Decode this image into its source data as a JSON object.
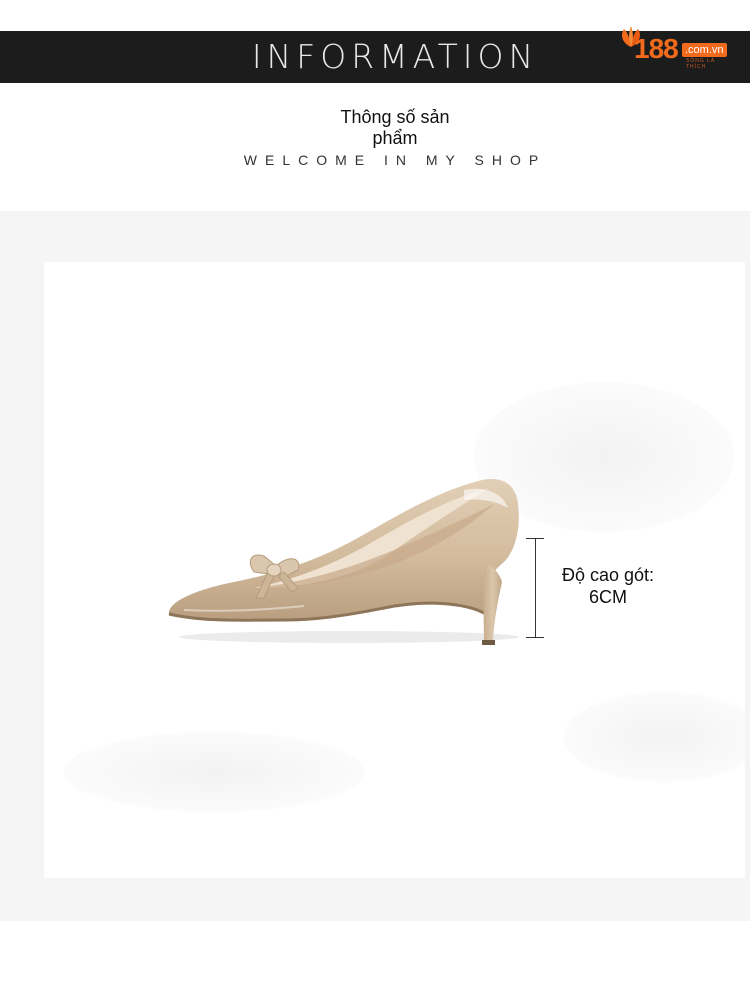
{
  "header": {
    "title": "INFORMATION",
    "background_color": "#1c1c1c",
    "logo": {
      "number": "188",
      "domain": ".com.vn",
      "tagline": "SỐNG LÀ THÍCH",
      "color": "#f26a1b"
    }
  },
  "intro": {
    "title": "Thông số sản phẩm",
    "subtitle": "WELCOME IN MY SHOP"
  },
  "product": {
    "image_alt": "beige-patent-pump-with-bow",
    "shoe_color": "#d8c2a8",
    "heel_label": "Độ cao gót:",
    "heel_value": "6CM"
  }
}
